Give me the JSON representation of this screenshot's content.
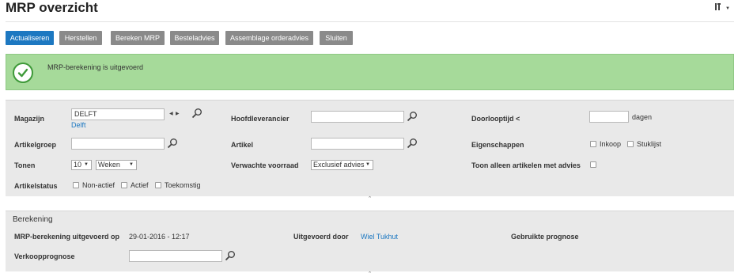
{
  "page": {
    "title": "MRP overzicht",
    "menu_icon_glyph": "ı̥ı",
    "menu_icon": "wrench-menu-icon"
  },
  "toolbar": {
    "actualiseren": "Actualiseren",
    "herstellen": "Herstellen",
    "bereken_mrp": "Bereken MRP",
    "besteladvies": "Besteladvies",
    "assemblage": "Assemblage orderadvies",
    "sluiten": "Sluiten"
  },
  "alert": {
    "message": "MRP-berekening is uitgevoerd",
    "icon": "check-circle-icon"
  },
  "filters": {
    "magazijn": {
      "label": "Magazijn",
      "value": "DELFT",
      "link": "Delft"
    },
    "hoofdleverancier": {
      "label": "Hoofdleverancier",
      "value": ""
    },
    "doorlooptijd": {
      "label": "Doorlooptijd <",
      "value": "",
      "unit": "dagen"
    },
    "artikelgroep": {
      "label": "Artikelgroep",
      "value": ""
    },
    "artikel": {
      "label": "Artikel",
      "value": ""
    },
    "eigenschappen": {
      "label": "Eigenschappen",
      "inkoop": "Inkoop",
      "stuklijst": "Stuklijst"
    },
    "tonen": {
      "label": "Tonen",
      "count": "10",
      "period": "Weken"
    },
    "verwachte_voorraad": {
      "label": "Verwachte voorraad",
      "value": "Exclusief advies"
    },
    "toon_alleen": {
      "label": "Toon alleen artikelen met advies"
    },
    "artikelstatus": {
      "label": "Artikelstatus",
      "non_actief": "Non-actief",
      "actief": "Actief",
      "toekomstig": "Toekomstig"
    }
  },
  "berekening": {
    "title": "Berekening",
    "uitgevoerd_op_label": "MRP-berekening uitgevoerd op",
    "uitgevoerd_op_value": "29-01-2016 - 12:17",
    "uitgevoerd_door_label": "Uitgevoerd door",
    "uitgevoerd_door_value": "Wiel Tukhut",
    "gebruikte_prognose_label": "Gebruikte prognose",
    "verkoopprognose_label": "Verkoopprognose",
    "verkoopprognose_value": ""
  },
  "colors": {
    "primary": "#1d78c1",
    "success_bg": "#a6da9a",
    "success_icon": "#3f9a3a",
    "button_grey": "#8a8a8a",
    "panel_bg": "#e9e9e9"
  }
}
